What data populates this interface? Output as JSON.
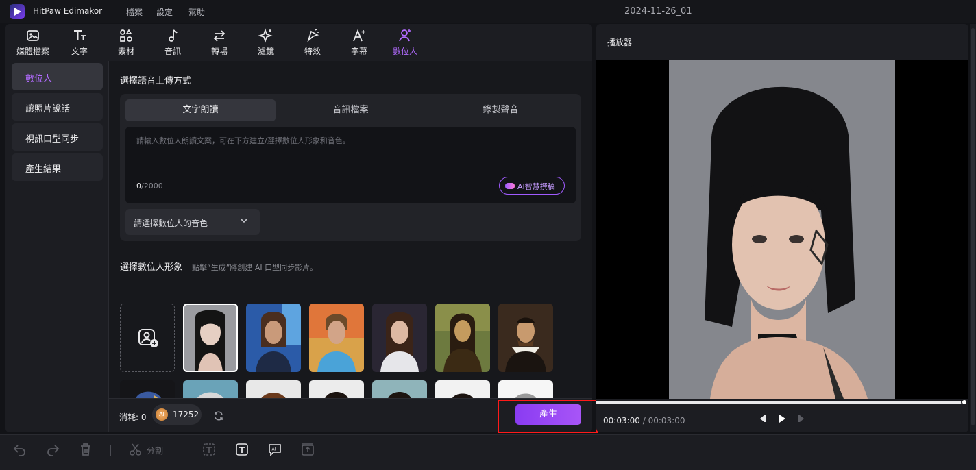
{
  "app": {
    "name": "HitPaw Edimakor",
    "project": "2024-11-26_01"
  },
  "menu": [
    "檔案",
    "設定",
    "幫助"
  ],
  "toolbar": [
    {
      "label": "媒體檔案",
      "icon": "media-icon"
    },
    {
      "label": "文字",
      "icon": "text-icon"
    },
    {
      "label": "素材",
      "icon": "elements-icon"
    },
    {
      "label": "音訊",
      "icon": "audio-icon"
    },
    {
      "label": "轉場",
      "icon": "transition-icon"
    },
    {
      "label": "濾鏡",
      "icon": "filter-icon"
    },
    {
      "label": "特效",
      "icon": "effects-icon"
    },
    {
      "label": "字幕",
      "icon": "subtitle-icon"
    },
    {
      "label": "數位人",
      "icon": "digital-human-icon"
    }
  ],
  "sidebar": [
    {
      "label": "數位人"
    },
    {
      "label": "讓照片說話"
    },
    {
      "label": "視訊口型同步"
    },
    {
      "label": "產生結果"
    }
  ],
  "upload": {
    "title": "選擇語音上傳方式",
    "tabs": [
      "文字朗讀",
      "音訊檔案",
      "錄製聲音"
    ],
    "placeholder": "請輸入數位人朗讀文案，可在下方建立/選擇數位人形象和音色。",
    "count_current": "0",
    "count_max": "/2000",
    "ai_button": "AI智慧撰稿",
    "voice_select": "請選擇數位人的音色"
  },
  "avatars": {
    "title": "選擇數位人形象",
    "hint": "點擊“生成”將創建 AI 口型同步影片。"
  },
  "footer": {
    "cost_label": "消耗: 0",
    "coin_label": "AI",
    "credits": "17252",
    "generate": "產生"
  },
  "player": {
    "title": "播放器",
    "current_time": "00:03:00",
    "separator": " / ",
    "total_time": "00:03:00"
  },
  "bottom": {
    "split_label": "分割"
  },
  "colors": {
    "accent": "#a855f7",
    "highlight": "#ff1a1a"
  }
}
